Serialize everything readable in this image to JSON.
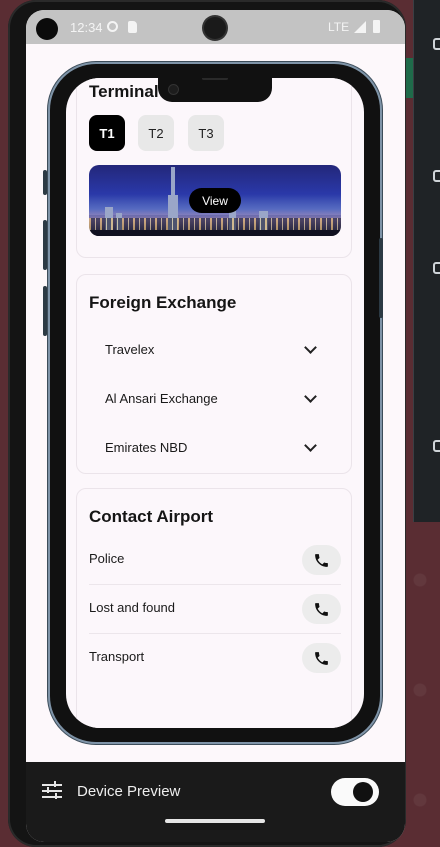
{
  "status_bar": {
    "time": "12:34",
    "network": "LTE"
  },
  "terminal_map": {
    "title": "Terminal Map",
    "terminals": [
      "T1",
      "T2",
      "T3"
    ],
    "selected": "T1",
    "view_label": "View"
  },
  "foreign_exchange": {
    "title": "Foreign Exchange",
    "items": [
      "Travelex",
      "Al Ansari Exchange",
      "Emirates NBD"
    ]
  },
  "contact_airport": {
    "title": "Contact Airport",
    "items": [
      "Police",
      "Lost and found",
      "Transport"
    ]
  },
  "device_preview": {
    "label": "Device Preview",
    "enabled": true
  },
  "colors": {
    "accent": "#000000",
    "surface": "#fcf7fb",
    "chip": "#e8e8e8"
  }
}
